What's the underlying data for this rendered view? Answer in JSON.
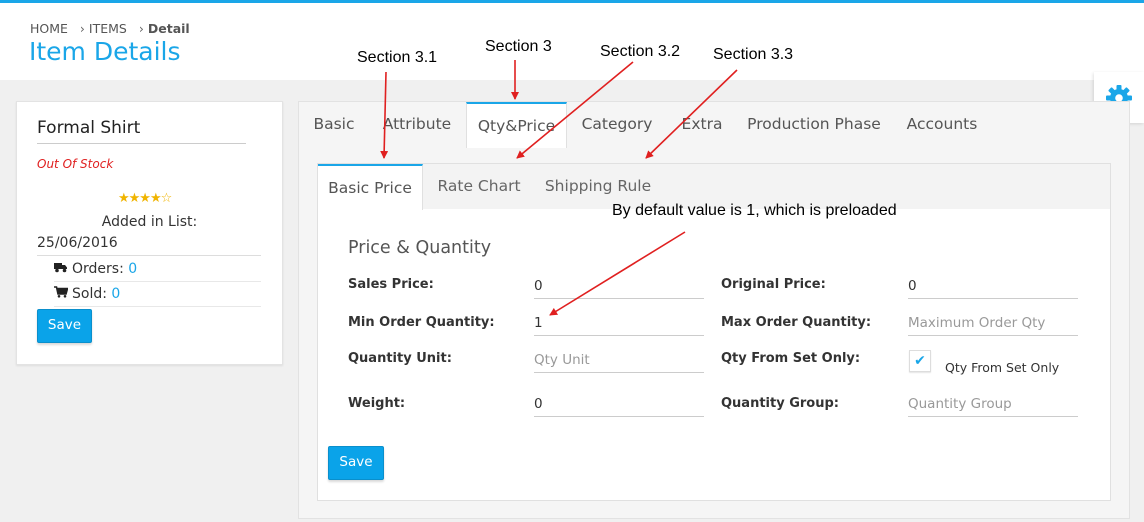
{
  "breadcrumb": {
    "home": "HOME",
    "items": "ITEMS",
    "current": "Detail",
    "separator": "›"
  },
  "page": {
    "title": "Item Details"
  },
  "item_card": {
    "name": "Formal Shirt",
    "stock_status": "Out Of Stock",
    "rating": {
      "value": 4,
      "max": 5,
      "stars_filled": "★★★★",
      "stars_empty": "☆"
    },
    "added_label": "Added in List:",
    "added_date": "25/06/2016",
    "orders_label": "Orders:",
    "orders_value": "0",
    "sold_label": "Sold:",
    "sold_value": "0",
    "save_label": "Save"
  },
  "main_tabs": [
    "Basic",
    "Attribute",
    "Qty&Price",
    "Category",
    "Extra",
    "Production Phase",
    "Accounts"
  ],
  "active_main_tab": "Qty&Price",
  "sub_tabs": [
    "Basic Price",
    "Rate Chart",
    "Shipping Rule"
  ],
  "active_sub_tab": "Basic Price",
  "form": {
    "section_title": "Price & Quantity",
    "sales_price_label": "Sales Price:",
    "sales_price_value": "0",
    "original_price_label": "Original Price:",
    "original_price_value": "0",
    "min_order_label": "Min Order Quantity:",
    "min_order_value": "1",
    "max_order_label": "Max Order Quantity:",
    "max_order_placeholder": "Maximum Order Qty",
    "qty_unit_label": "Quantity Unit:",
    "qty_unit_placeholder": "Qty Unit",
    "qty_from_set_label": "Qty From Set Only:",
    "qty_from_set_checked": true,
    "qty_from_set_check_glyph": "✔",
    "qty_from_set_checkbox_text": "Qty From Set Only",
    "weight_label": "Weight:",
    "weight_value": "0",
    "quantity_group_label": "Quantity Group:",
    "quantity_group_placeholder": "Quantity Group",
    "save_label": "Save"
  },
  "annotations": {
    "section_3": "Section 3",
    "section_3_1": "Section 3.1",
    "section_3_2": "Section 3.2",
    "section_3_3": "Section 3.3",
    "default_note": "By default value is 1, which is preloaded"
  },
  "icons": {
    "orders": "truck-icon",
    "sold": "cart-icon",
    "settings": "gear-icon",
    "rating": "star-icon",
    "checkbox": "check-icon"
  },
  "colors": {
    "accent": "#1aa6e8",
    "button": "#0aa3e9",
    "out_of_stock": "#e02020",
    "star": "#f0b400",
    "annotation_arrow": "#e02020"
  }
}
